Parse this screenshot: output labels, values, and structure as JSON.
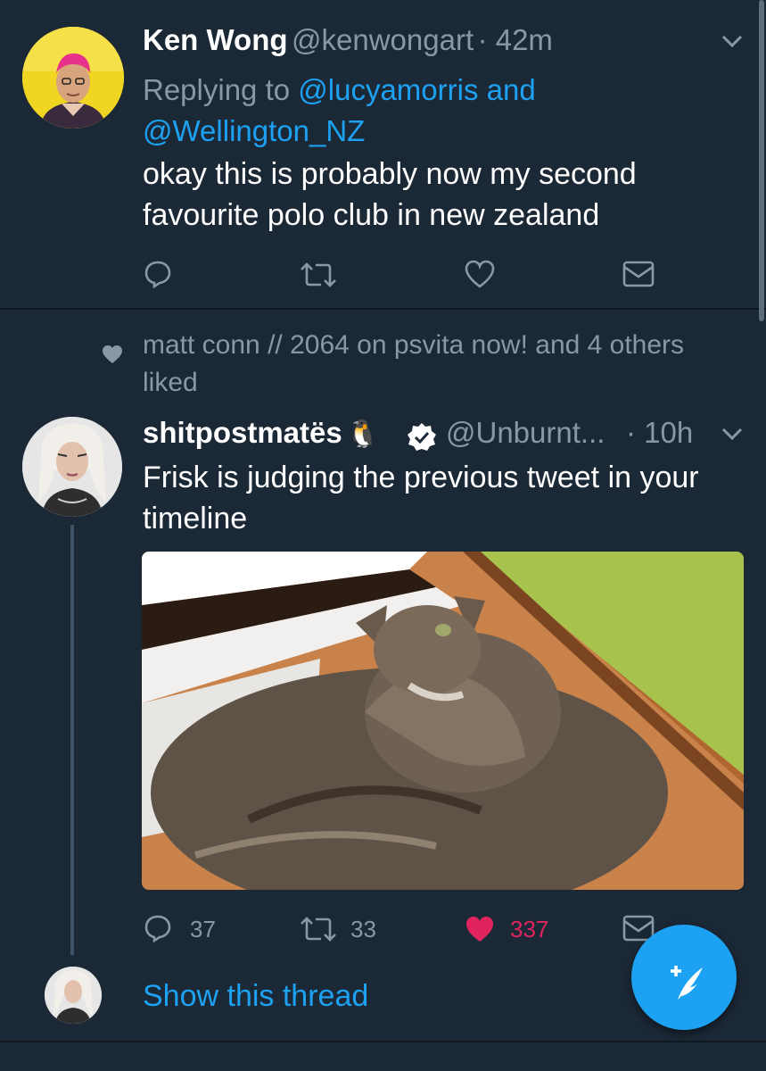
{
  "tweet1": {
    "name": "Ken Wong",
    "handle": "@kenwongart",
    "time": "· 42m",
    "replying_prefix": "Replying to ",
    "reply_link1": "@lucyamorris and",
    "reply_link2": "@Wellington_NZ",
    "text_line1": "okay this is probably now my second",
    "text_line2": "favourite polo club in new zealand"
  },
  "liked_context": {
    "line1": "matt conn // 2064 on psvita now! and 4 others",
    "line2": "liked"
  },
  "tweet2": {
    "name": "shitpostmatës",
    "emoji": "🐧",
    "handle": "@Unburnt...",
    "time": "· 10h",
    "text_line1": "Frisk is judging the previous tweet in your",
    "text_line2": "timeline",
    "reply_count": "37",
    "retweet_count": "33",
    "like_count": "337"
  },
  "thread": {
    "show_label": "Show this thread"
  },
  "colors": {
    "background": "#1b2836",
    "accent": "#1da1f2",
    "like": "#e0245e",
    "muted": "#8899a6"
  },
  "icons": [
    "chevron-down-icon",
    "reply-icon",
    "retweet-icon",
    "heart-icon",
    "dm-icon",
    "verified-badge-icon",
    "compose-tweet-icon"
  ]
}
